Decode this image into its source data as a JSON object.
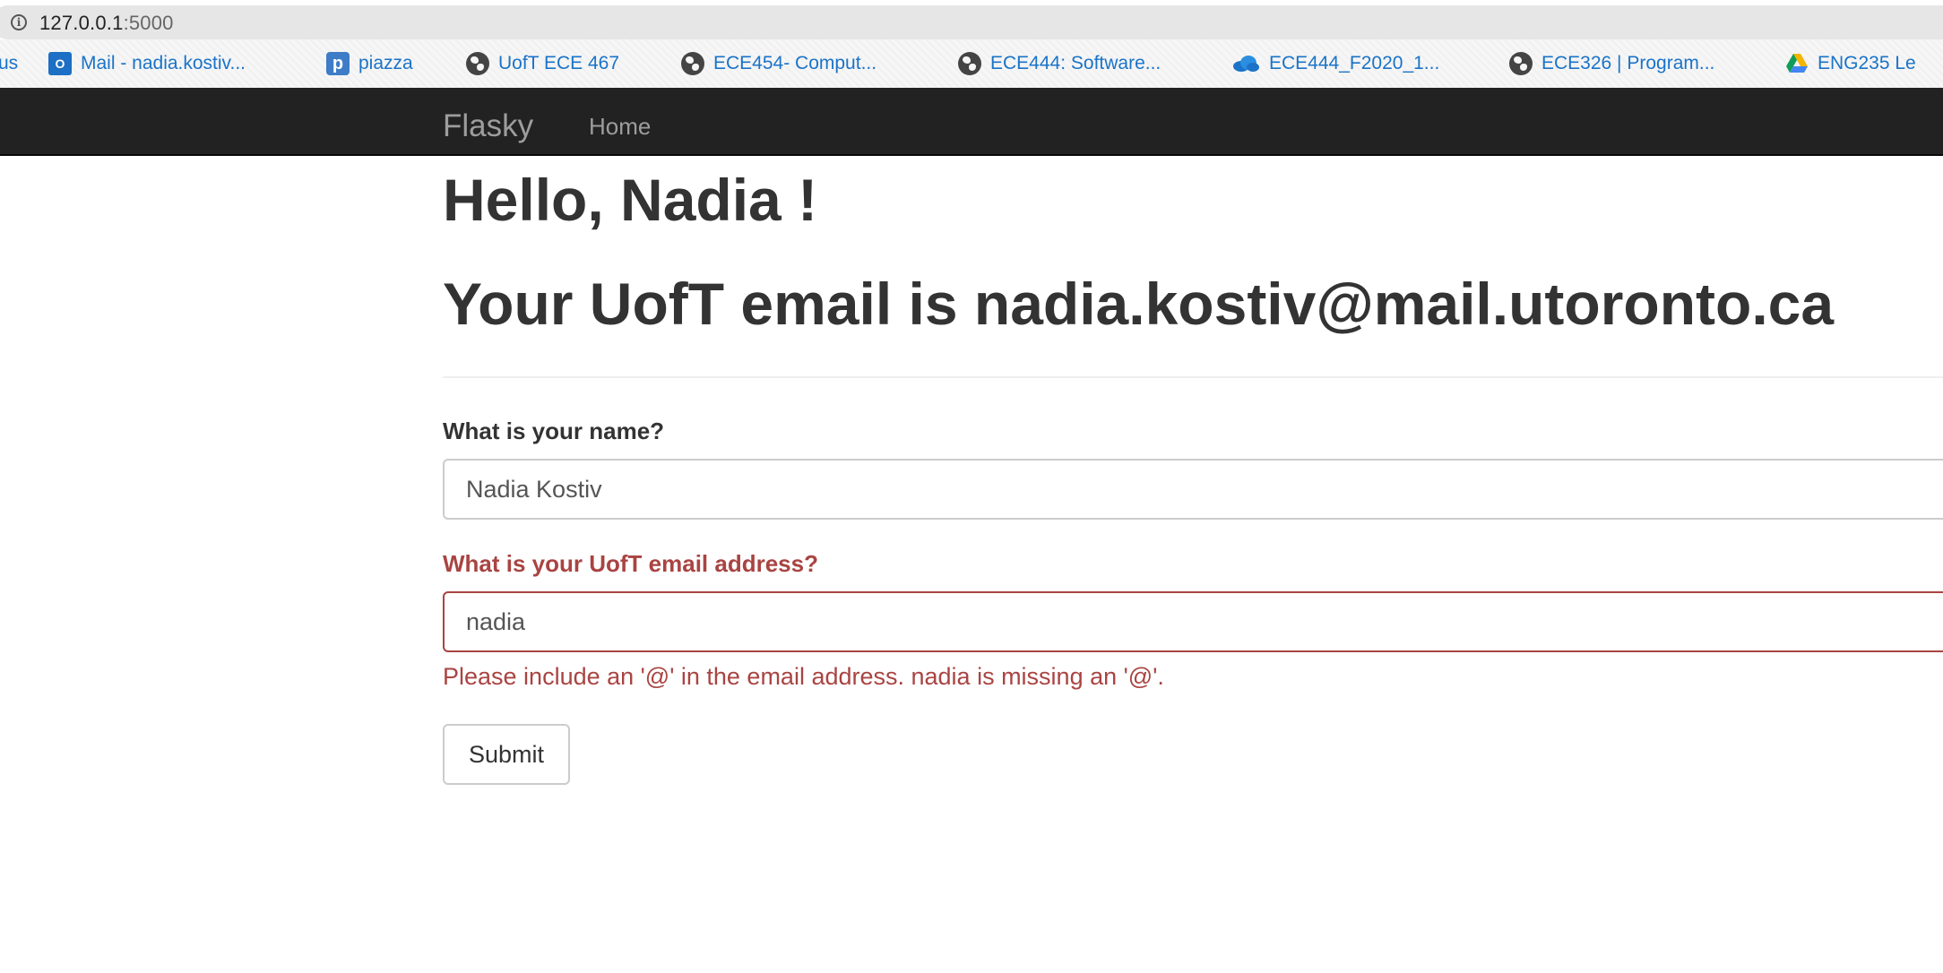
{
  "browser": {
    "url_host": "127.0.0.1",
    "url_port": ":5000",
    "bookmarks": [
      {
        "label": "us",
        "icon": "none"
      },
      {
        "label": "Mail - nadia.kostiv...",
        "icon": "outlook-icon"
      },
      {
        "label": "piazza",
        "icon": "piazza-icon"
      },
      {
        "label": "UofT ECE 467",
        "icon": "globe-icon"
      },
      {
        "label": "ECE454- Comput...",
        "icon": "globe-icon"
      },
      {
        "label": "ECE444: Software...",
        "icon": "globe-icon"
      },
      {
        "label": "ECE444_F2020_1...",
        "icon": "onedrive-icon"
      },
      {
        "label": "ECE326 | Program...",
        "icon": "globe-icon"
      },
      {
        "label": "ENG235 Le",
        "icon": "google-drive-icon"
      }
    ]
  },
  "navbar": {
    "brand": "Flasky",
    "home": "Home"
  },
  "page": {
    "greeting": "Hello, Nadia !",
    "email_line": "Your UofT email is nadia.kostiv@mail.utoronto.ca"
  },
  "form": {
    "name_label": "What is your name?",
    "name_value": "Nadia Kostiv",
    "email_label": "What is your UofT email address?",
    "email_value": "nadia",
    "email_error": "Please include an '@' in the email address. nadia is missing an '@'.",
    "submit_label": "Submit"
  },
  "colors": {
    "navbar_bg": "#222222",
    "error": "#a94442",
    "link": "#1a73c8"
  }
}
